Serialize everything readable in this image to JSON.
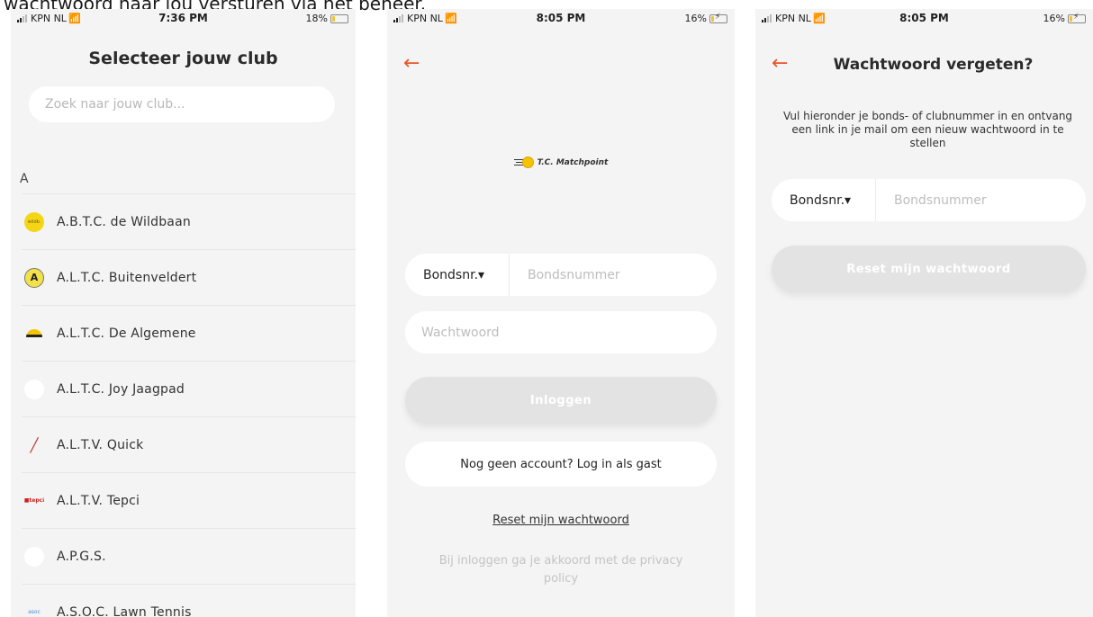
{
  "caption": "wachtwoord naar jou versturen via het beheer.",
  "phone1": {
    "status": {
      "carrier": "KPN NL",
      "time": "7:36 PM",
      "battery": "18%",
      "battery_level": 0.18
    },
    "title": "Selecteer jouw club",
    "search_placeholder": "Zoek naar jouw club...",
    "section_letter": "A",
    "clubs": [
      {
        "name": "A.B.T.C. de Wildbaan",
        "logo": "wildbaan-logo"
      },
      {
        "name": "A.L.T.C. Buitenveldert",
        "logo": "buitenveldert-logo"
      },
      {
        "name": "A.L.T.C. De Algemene",
        "logo": "algemene-logo"
      },
      {
        "name": "A.L.T.C. Joy Jaagpad",
        "logo": "blank-logo"
      },
      {
        "name": "A.L.T.V. Quick",
        "logo": "racket-logo"
      },
      {
        "name": "A.L.T.V. Tepci",
        "logo": "tepci-logo"
      },
      {
        "name": "A.P.G.S.",
        "logo": "blank-logo"
      },
      {
        "name": "A.S.O.C. Lawn Tennis",
        "logo": "asoc-logo"
      }
    ]
  },
  "phone2": {
    "status": {
      "carrier": "KPN NL",
      "time": "8:05 PM",
      "battery": "16%",
      "battery_level": 0.16
    },
    "back_icon": "back-arrow-icon",
    "brand": "T.C. Matchpoint",
    "id_select": "Bondsnr.▾",
    "id_placeholder": "Bondsnummer",
    "password_placeholder": "Wachtwoord",
    "login_button": "Inloggen",
    "guest_button": "Nog geen account? Log in als gast",
    "reset_link": "Reset mijn wachtwoord",
    "terms": "Bij inloggen ga je akkoord met de privacy policy"
  },
  "phone3": {
    "status": {
      "carrier": "KPN NL",
      "time": "8:05 PM",
      "battery": "16%",
      "battery_level": 0.16
    },
    "back_icon": "back-arrow-icon",
    "title": "Wachtwoord vergeten?",
    "description": "Vul hieronder je bonds- of clubnummer in en ontvang een link in je mail om een nieuw wachtwoord in te stellen",
    "id_select": "Bondsnr.▾",
    "id_placeholder": "Bondsnummer",
    "reset_button": "Reset mijn wachtwoord"
  },
  "colors": {
    "accent": "#e8572c",
    "background": "#f4f4f4",
    "disabled_button": "#e3e3e3",
    "brand_yellow": "#f5c400"
  }
}
